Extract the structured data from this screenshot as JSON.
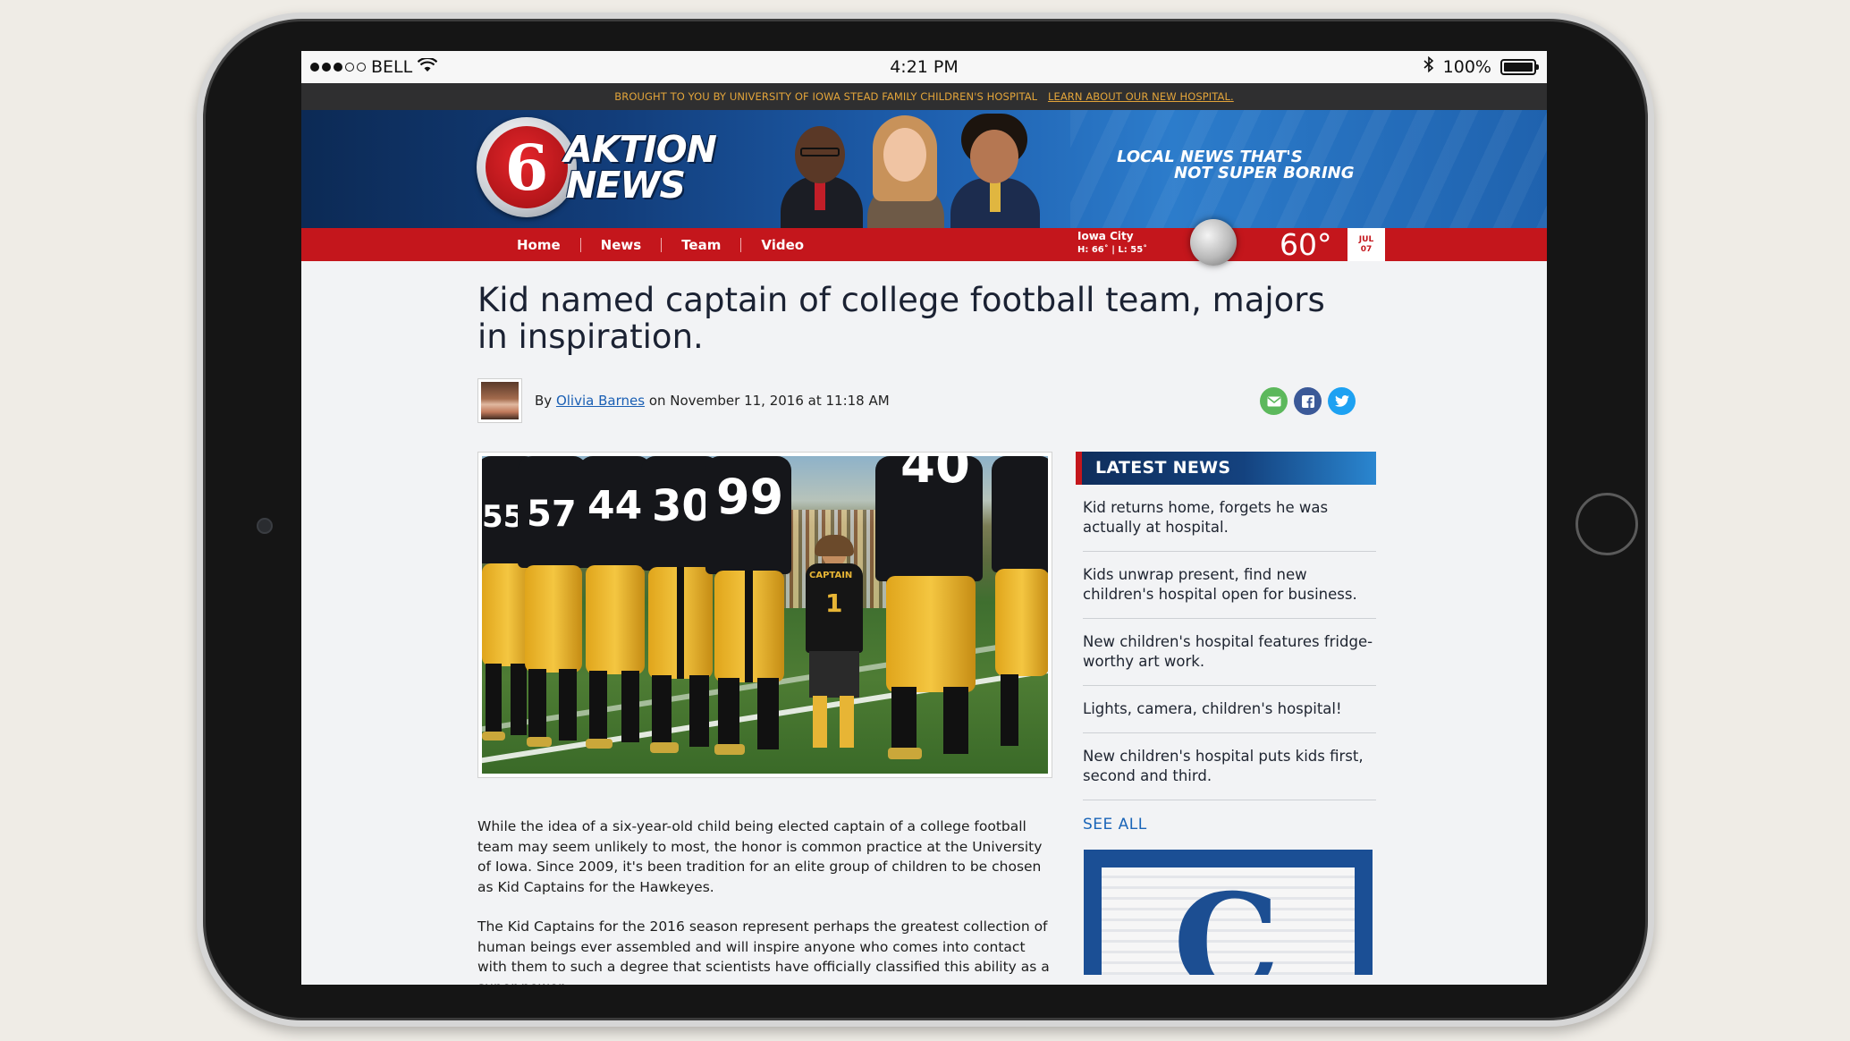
{
  "status_bar": {
    "carrier": "BELL",
    "time": "4:21 PM",
    "battery": "100%",
    "battery_level": 1.0
  },
  "sponsor": {
    "text": "BROUGHT TO YOU BY UNIVERSITY OF IOWA STEAD FAMILY CHILDREN'S HOSPITAL",
    "link": "LEARN ABOUT OUR NEW HOSPITAL."
  },
  "header": {
    "logo_numeral": "6",
    "logo_line1": "AKTION",
    "logo_line2": "NEWS",
    "tagline_line1": "LOCAL NEWS THAT'S",
    "tagline_line2": "NOT SUPER BORING"
  },
  "nav": {
    "items": [
      {
        "label": "Home"
      },
      {
        "label": "News"
      },
      {
        "label": "Team"
      },
      {
        "label": "Video"
      }
    ]
  },
  "weather": {
    "city": "Iowa City",
    "high_low": "H: 66˚  |  L: 55˚",
    "temp": "60°",
    "month": "JUL",
    "day": "07"
  },
  "article": {
    "title": "Kid named captain of college football team, majors in inspiration.",
    "by": "By",
    "author": "Olivia Barnes",
    "date": "on November 11, 2016 at 11:18 AM",
    "photo_numbers": [
      "55",
      "57",
      "44",
      "30",
      "99",
      "40"
    ],
    "kid_jersey_text": "CAPTAIN",
    "kid_number": "1",
    "paragraphs": [
      "While the idea of a six-year-old child being elected captain of a college football team may seem unlikely to most, the honor is common practice at the University of Iowa. Since 2009, it's been tradition for an elite group of children to be chosen as Kid Captains for the Hawkeyes.",
      "The Kid Captains for the 2016 season represent perhaps the greatest collection of human beings ever assembled and will inspire anyone who comes into contact with them to such a degree that scientists have officially classified this ability as a super power."
    ]
  },
  "share": {
    "email_color": "#5cb85c",
    "facebook_color": "#3b5998",
    "twitter_color": "#1da1f2"
  },
  "sidebar": {
    "header": "LATEST NEWS",
    "items": [
      {
        "text": "Kid returns home, forgets he was actually at hospital."
      },
      {
        "text": "Kids unwrap present, find new children's hospital open for business."
      },
      {
        "text": "New children's hospital features fridge-worthy art work."
      },
      {
        "text": "Lights, camera, children's hospital!"
      },
      {
        "text": "New children's hospital puts kids first, second and third."
      }
    ],
    "see_all": "SEE ALL",
    "ad_letter": "C"
  },
  "colors": {
    "brand_red": "#c4161c",
    "brand_blue": "#14427f",
    "link_blue": "#1a65b8"
  }
}
